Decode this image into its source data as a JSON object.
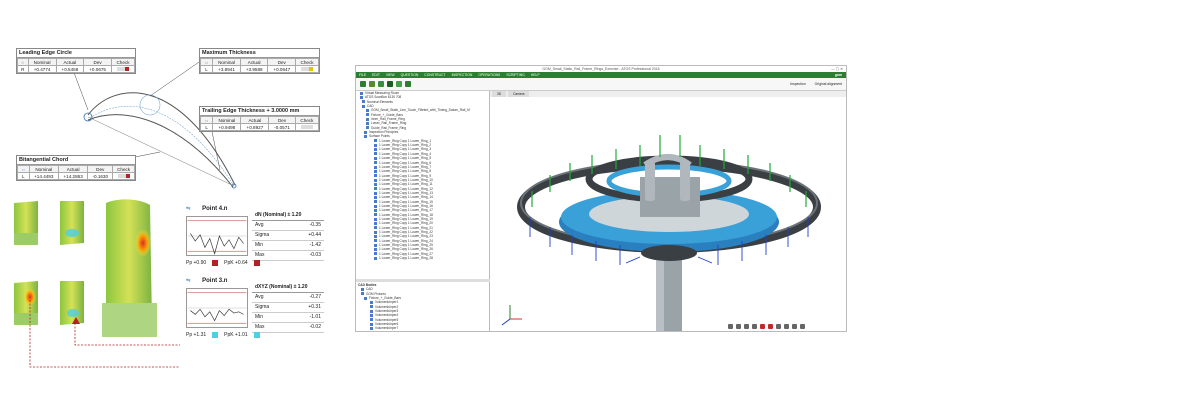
{
  "leading_edge": {
    "title": "Leading Edge Circle",
    "headers": [
      "",
      "Nominal",
      "Actual",
      "Dev",
      "Check"
    ],
    "row": {
      "axis": "R",
      "nominal": "+0.4774",
      "actual": "+0.5458",
      "dev": "+0.0675"
    }
  },
  "max_thickness": {
    "title": "Maximum Thickness",
    "headers": [
      "",
      "Nominal",
      "Actual",
      "Dev",
      "Check"
    ],
    "row": {
      "axis": "L",
      "nominal": "+3.8941",
      "actual": "+3.9588",
      "dev": "+0.0647"
    }
  },
  "trailing_edge": {
    "title": "Trailing Edge Thickness + 3.0000 mm",
    "headers": [
      "",
      "Nominal",
      "Actual",
      "Dev",
      "Check"
    ],
    "row": {
      "axis": "L",
      "nominal": "+0.9498",
      "actual": "+0.8927",
      "dev": "-0.0571"
    }
  },
  "bitangential": {
    "title": "Bitangential Chord",
    "headers": [
      "",
      "Nominal",
      "Actual",
      "Dev",
      "Check"
    ],
    "row": {
      "axis": "L",
      "nominal": "+14.4493",
      "actual": "+14.2863",
      "dev": "-0.1630"
    }
  },
  "point4": {
    "title": "Point 4.n",
    "header": "dN (Nominal) ± 1.20",
    "stats": [
      {
        "label": "Avg",
        "value": "-0.35"
      },
      {
        "label": "Sigma",
        "value": "+0.44"
      },
      {
        "label": "Min",
        "value": "-1.42"
      },
      {
        "label": "Max",
        "value": "-0.03"
      }
    ],
    "pp": "Pp +0.90",
    "ppk": "PpK +0.64",
    "series": [
      0.2,
      -0.4,
      0.1,
      -0.9,
      -0.2,
      -1.4,
      0.0,
      -0.8,
      -0.3,
      -1.0,
      -0.1,
      -0.6
    ]
  },
  "point3": {
    "title": "Point 3.n",
    "header": "dXYZ (Nominal) ± 1.20",
    "stats": [
      {
        "label": "Avg",
        "value": "-0.27"
      },
      {
        "label": "Sigma",
        "value": "+0.31"
      },
      {
        "label": "Min",
        "value": "-1.01"
      },
      {
        "label": "Max",
        "value": "-0.02"
      }
    ],
    "pp": "Pp +1.31",
    "ppk": "PpK +1.01",
    "series": [
      -0.2,
      -0.5,
      -0.1,
      -0.7,
      -0.3,
      -1.0,
      -0.2,
      -0.6,
      -0.1,
      -0.4,
      -0.3,
      -0.5
    ]
  },
  "window": {
    "title": "GOM_Small_Static_Rail_Frame_Rings_Exercise - ATOS Professional 2016",
    "menu": [
      "FILE",
      "EDIT",
      "VIEW",
      "QUESTION",
      "CONSTRUCT",
      "INSPECTION",
      "OPERATIONS",
      "SCRIPTING",
      "HELP"
    ],
    "brand": "gom",
    "tabs": [
      "3D",
      "Camera"
    ],
    "tree_top": [
      "Virtual Measuring Room",
      "ATOS ScanBox 6130 708",
      "Nominal Elements",
      "CAD",
      "GOM_Small_Static_Line_Touch_Filleted_with_Timing_Datum_Rail_M",
      "Fixture_+_Guide_Bars",
      "Inner_Rail_Frame_Ring",
      "Lower_Rail_Frame_Ring",
      "Guide_Rail_Frame_Ring",
      "Inspection Principles",
      "Surface Points",
      "1 Lower_Ring Copy 1 Lower_Ring_1",
      "1 Lower_Ring Copy 1 Lower_Ring_2",
      "1 Lower_Ring Copy 1 Lower_Ring_3",
      "1 Lower_Ring Copy 1 Lower_Ring_4",
      "1 Lower_Ring Copy 1 Lower_Ring_5",
      "1 Lower_Ring Copy 1 Lower_Ring_6",
      "1 Lower_Ring Copy 1 Lower_Ring_7",
      "1 Lower_Ring Copy 1 Lower_Ring_8",
      "1 Lower_Ring Copy 1 Lower_Ring_9",
      "1 Lower_Ring Copy 1 Lower_Ring_10",
      "1 Lower_Ring Copy 1 Lower_Ring_11",
      "1 Lower_Ring Copy 1 Lower_Ring_12",
      "1 Lower_Ring Copy 1 Lower_Ring_13",
      "1 Lower_Ring Copy 1 Lower_Ring_14",
      "1 Lower_Ring Copy 1 Lower_Ring_15",
      "1 Lower_Ring Copy 1 Lower_Ring_16",
      "1 Lower_Ring Copy 1 Lower_Ring_17",
      "1 Lower_Ring Copy 1 Lower_Ring_18",
      "1 Lower_Ring Copy 1 Lower_Ring_19",
      "1 Lower_Ring Copy 1 Lower_Ring_20",
      "1 Lower_Ring Copy 1 Lower_Ring_21",
      "1 Lower_Ring Copy 1 Lower_Ring_22",
      "1 Lower_Ring Copy 1 Lower_Ring_23",
      "1 Lower_Ring Copy 1 Lower_Ring_24",
      "1 Lower_Ring Copy 1 Lower_Ring_25",
      "1 Lower_Ring Copy 1 Lower_Ring_26",
      "1 Lower_Ring Copy 1 Lower_Ring_27",
      "1 Lower_Ring Copy 1 Lower_Ring_28"
    ],
    "tree_bottom_header": "CAD Bodies",
    "tree_bottom": [
      "CAD",
      "GOM Fixtures",
      "Fixture_+_Guide_Bars",
      "Volumenkörper1",
      "Volumenkörper2",
      "Volumenkörper3",
      "Volumenkörper4",
      "Volumenkörper5",
      "Volumenkörper6",
      "Volumenkörper7",
      "Volumenkörper8",
      "Volumenkörper9",
      "Volumenkörper10",
      "Volumenkörper11",
      "Volumenkörper12",
      "Volumenkörper13"
    ],
    "inspection_label": "Inspection",
    "alignment_label": "Original alignment"
  },
  "colors": {
    "green": "#2e7d32",
    "deviation_green": "#5cb85c",
    "accent_red": "#b22222",
    "ring_blue": "#3aa0d8"
  }
}
